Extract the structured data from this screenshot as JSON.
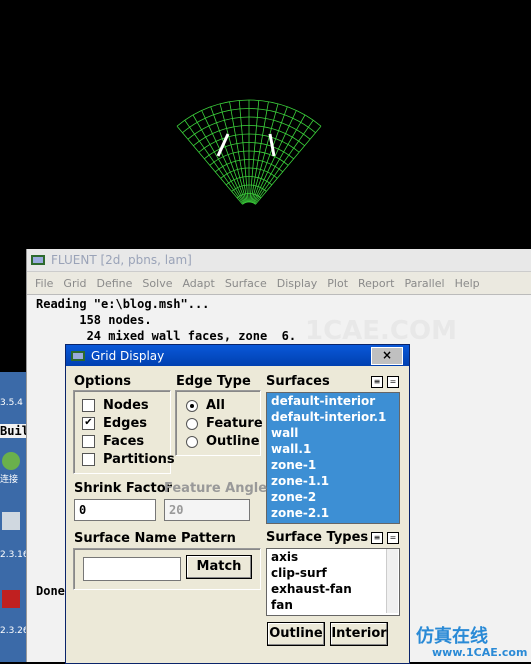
{
  "colors": {
    "mesh": "#3cd33c",
    "selection": "#3d8fd4",
    "dialog_title": "#0a58d8"
  },
  "desktop": {
    "labels": [
      "3.5.4",
      "Buil",
      "连接",
      "2.3.16",
      "2.3.26"
    ]
  },
  "console": {
    "title": "FLUENT  [2d, pbns, lam]",
    "menu": [
      "File",
      "Grid",
      "Define",
      "Solve",
      "Adapt",
      "Surface",
      "Display",
      "Plot",
      "Report",
      "Parallel",
      "Help"
    ],
    "lines": [
      "Reading \"e:\\blog.msh\"...",
      "      158 nodes.",
      "       24 mixed wall faces, zone  6."
    ],
    "watermark": "1CAE.COM",
    "done_text": "Done"
  },
  "dialog": {
    "title": "Grid Display",
    "close_label": "×",
    "options": {
      "label": "Options",
      "items": [
        {
          "label": "Nodes",
          "checked": false
        },
        {
          "label": "Edges",
          "checked": true
        },
        {
          "label": "Faces",
          "checked": false
        },
        {
          "label": "Partitions",
          "checked": false
        }
      ]
    },
    "edge_type": {
      "label": "Edge Type",
      "items": [
        {
          "label": "All",
          "selected": true
        },
        {
          "label": "Feature",
          "selected": false
        },
        {
          "label": "Outline",
          "selected": false
        }
      ]
    },
    "surfaces": {
      "label": "Surfaces",
      "items": [
        "default-interior",
        "default-interior.1",
        "wall",
        "wall.1",
        "zone-1",
        "zone-1.1",
        "zone-2",
        "zone-2.1"
      ]
    },
    "shrink_factor": {
      "label": "Shrink Factor",
      "value": "0"
    },
    "feature_angle": {
      "label": "Feature Angle",
      "value": "20"
    },
    "surface_name_pattern": {
      "label": "Surface Name Pattern",
      "value": "",
      "match_label": "Match"
    },
    "surface_types": {
      "label": "Surface Types",
      "items": [
        "axis",
        "clip-surf",
        "exhaust-fan",
        "fan"
      ]
    },
    "outline_label": "Outline",
    "interior_label": "Interior"
  },
  "watermark_logo": {
    "text": "仿真在线",
    "sub": "www.1CAE.com"
  }
}
